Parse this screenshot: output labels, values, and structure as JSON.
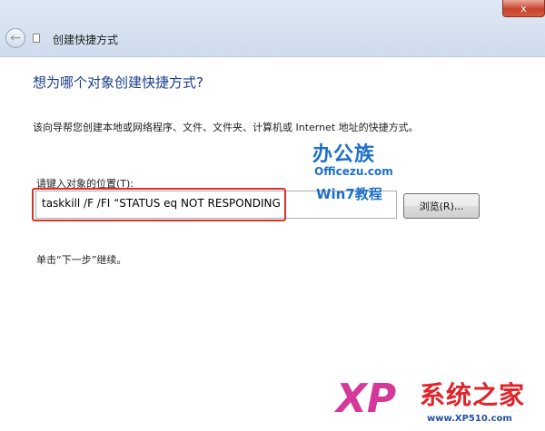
{
  "window": {
    "title": "创建快捷方式",
    "close_glyph": "x"
  },
  "wizard": {
    "heading": "想为哪个对象创建快捷方式?",
    "description": "该向导帮您创建本地或网络程序、文件、文件夹、计算机或 Internet 地址的快捷方式。",
    "location_label": "请键入对象的位置(T):",
    "location_value": "taskkill /F /FI  “STATUS eq NOT RESPONDING",
    "browse_label": "浏览(R)...",
    "hint": "单击“下一步”继续。"
  },
  "watermarks": {
    "officezu_cn": "办公族",
    "officezu_en": "Officezu.com",
    "win7": "Win7教程",
    "xp_mark": "XP",
    "xp_cn": "系统之家",
    "xp_url": "www.XP510.com"
  },
  "colors": {
    "heading": "#1a3e8c",
    "highlight_box": "#d8322d",
    "titlebar": "#dfe9f5"
  },
  "icons": [
    "back-arrow-icon",
    "shortcut-app-icon",
    "close-icon"
  ]
}
